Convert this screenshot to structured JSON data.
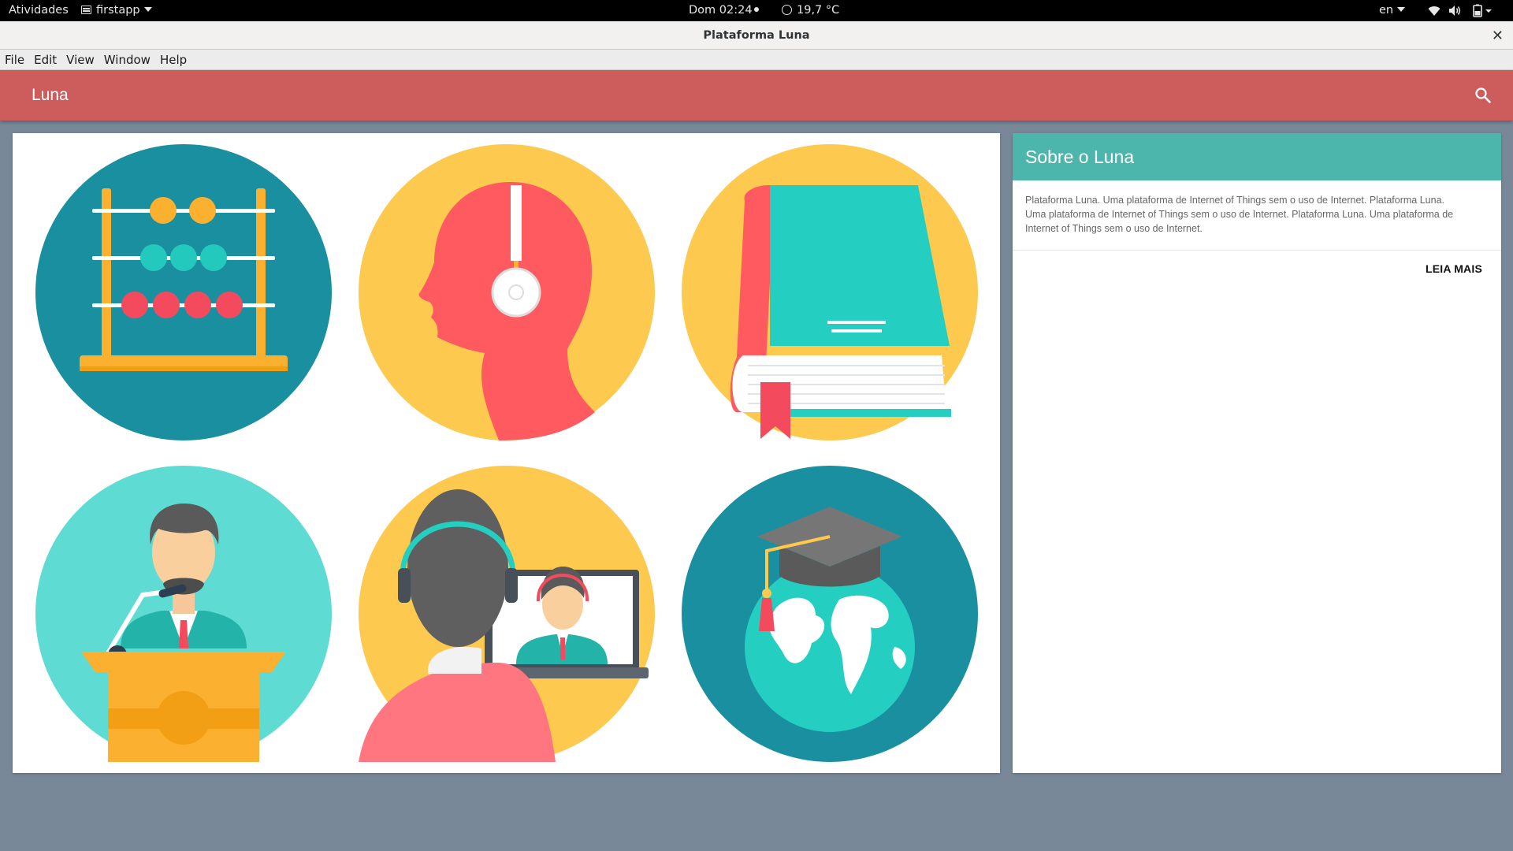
{
  "topbar": {
    "activities": "Atividades",
    "app_name": "firstapp",
    "clock": "Dom 02:24",
    "weather": "19,7 °C",
    "language": "en",
    "icons": [
      "wifi-icon",
      "volume-icon",
      "power-icon"
    ]
  },
  "window": {
    "title": "Plataforma Luna",
    "close_glyph": "✕"
  },
  "menubar": {
    "items": [
      "File",
      "Edit",
      "View",
      "Window",
      "Help"
    ]
  },
  "appbar": {
    "brand": "Luna",
    "icon": "search-icon",
    "color": "#cd5c5c"
  },
  "gallery": {
    "tiles": [
      "abacus-icon",
      "head-headphones-icon",
      "book-icon",
      "speaker-podium-icon",
      "video-call-icon",
      "graduation-globe-icon"
    ]
  },
  "side_card": {
    "title": "Sobre o Luna",
    "body": "Plataforma Luna. Uma plataforma de Internet of Things sem o uso de Internet. Plataforma Luna. Uma plataforma de Internet of Things sem o uso de Internet. Plataforma Luna. Uma plataforma de Internet of Things sem o uso de Internet.",
    "action": "LEIA MAIS",
    "header_color": "#4db6ac"
  },
  "colors": {
    "desktop": "#788899",
    "teal_dark": "#1a8fa0",
    "teal_light": "#5edcd3",
    "yellow": "#fdc94f",
    "coral": "#ff5a5f"
  }
}
